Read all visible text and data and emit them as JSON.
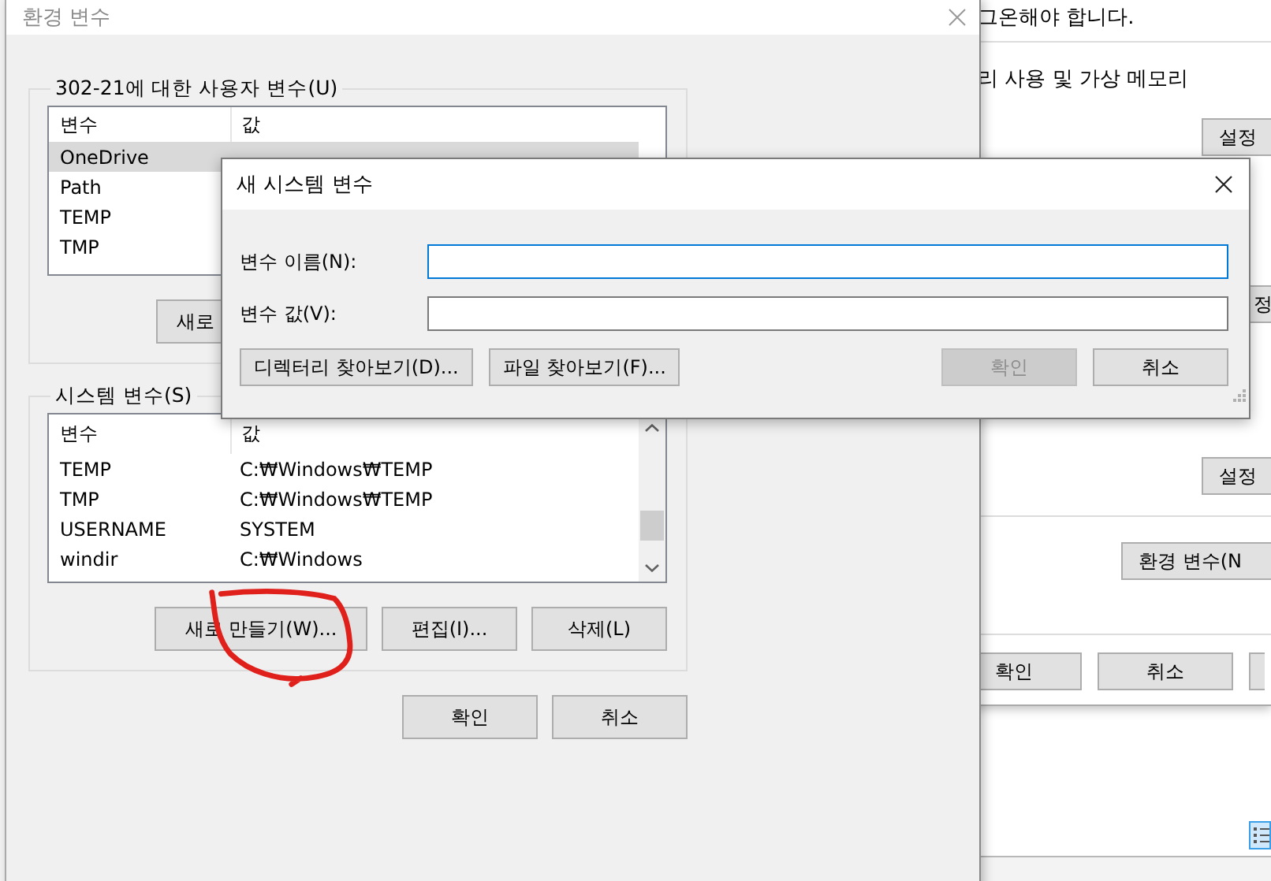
{
  "background_window": {
    "notice": "그온해야 합니다.",
    "section_label": "리 사용 및 가상 메모리",
    "settings_buttons": [
      "설정",
      "정",
      "설정"
    ],
    "env_button": "환경 변수(N",
    "footer_buttons": [
      "확인",
      "취소"
    ]
  },
  "env_dialog": {
    "title": "환경 변수",
    "user_group": {
      "label": "302-21에 대한 사용자 변수(U)",
      "columns": [
        "변수",
        "값"
      ],
      "rows": [
        {
          "name": "OneDrive",
          "selected": true
        },
        {
          "name": "Path",
          "selected": false
        },
        {
          "name": "TEMP",
          "selected": false
        },
        {
          "name": "TMP",
          "selected": false
        }
      ],
      "button": "새로"
    },
    "system_group": {
      "label": "시스템 변수(S)",
      "columns": [
        "변수",
        "값"
      ],
      "rows": [
        {
          "name": "TEMP",
          "value": "C:₩Windows₩TEMP",
          "selected": false
        },
        {
          "name": "TMP",
          "value": "C:₩Windows₩TEMP",
          "selected": false
        },
        {
          "name": "USERNAME",
          "value": "SYSTEM",
          "selected": false
        },
        {
          "name": "windir",
          "value": "C:₩Windows",
          "selected": false
        }
      ],
      "buttons": [
        "새로 만들기(W)...",
        "편집(I)...",
        "삭제(L)"
      ]
    },
    "buttons": [
      "확인",
      "취소"
    ]
  },
  "new_variable_dialog": {
    "title": "새 시스템 변수",
    "fields": [
      {
        "label": "변수 이름(N):",
        "focused": true
      },
      {
        "label": "변수 값(V):",
        "focused": false
      }
    ],
    "browse_buttons": [
      "디렉터리 찾아보기(D)...",
      "파일 찾아보기(F)..."
    ],
    "buttons": [
      {
        "label": "확인",
        "disabled": true
      },
      {
        "label": "취소",
        "disabled": false
      }
    ]
  }
}
